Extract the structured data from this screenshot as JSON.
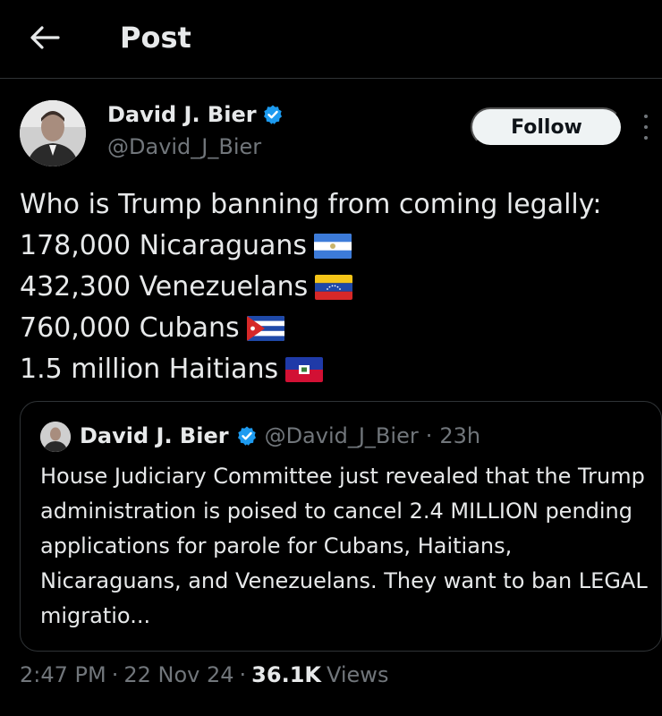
{
  "header": {
    "title": "Post"
  },
  "post": {
    "author_name": "David J. Bier",
    "author_handle": "@David_J_Bier",
    "follow_label": "Follow",
    "lines": [
      {
        "text": "Who is Trump banning from coming legally:",
        "flag": ""
      },
      {
        "text": "178,000 Nicaraguans",
        "flag": "nicaragua-flag-icon"
      },
      {
        "text": "432,300 Venezuelans",
        "flag": "venezuela-flag-icon"
      },
      {
        "text": "760,000 Cubans",
        "flag": "cuba-flag-icon"
      },
      {
        "text": "1.5 million Haitians",
        "flag": "haiti-flag-icon"
      }
    ],
    "quote": {
      "author_name": "David J. Bier",
      "author_handle": "@David_J_Bier",
      "separator": "·",
      "time": "23h",
      "body": "House Judiciary Committee just revealed that the Trump administration is poised to cancel 2.4 MILLION pending applications for parole for Cubans, Haitians, Nicaraguans, and Venezuelans. They want to ban LEGAL migratio..."
    },
    "meta": {
      "time": "2:47 PM",
      "sep1": "·",
      "date": "22 Nov 24",
      "sep2": "·",
      "views_count": "36.1K",
      "views_label": "Views"
    }
  },
  "colors": {
    "background": "#000000",
    "text_primary": "#e7e9ea",
    "text_secondary": "#71767b",
    "verified_blue": "#1d9bf0",
    "border": "#2f3336"
  }
}
